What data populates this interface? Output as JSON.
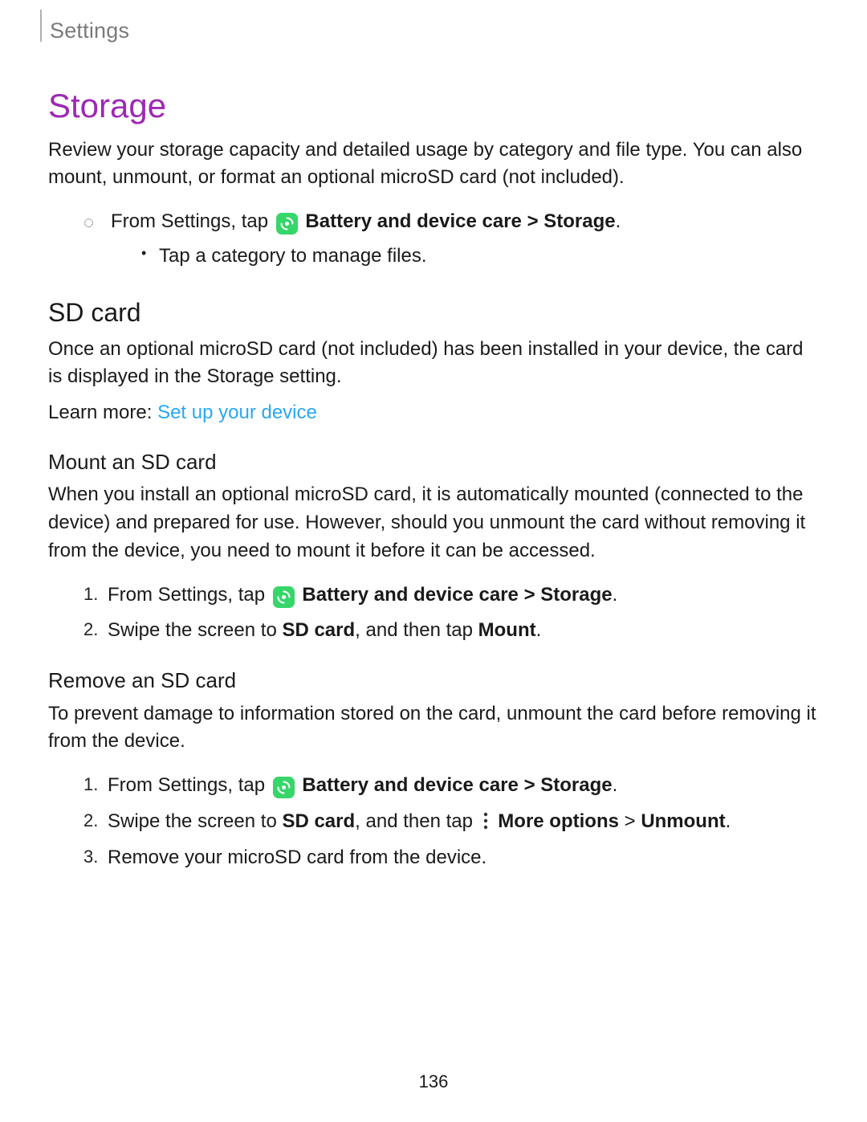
{
  "breadcrumb": "Settings",
  "h1": "Storage",
  "intro": "Review your storage capacity and detailed usage by category and file type.  You can also mount, unmount, or format an optional microSD card (not included).",
  "from_settings_tap": "From Settings, tap",
  "battery_storage_bold": " Battery and device care > Storage",
  "period": ".",
  "tap_category": "Tap a category to manage files.",
  "sd_card": {
    "h2": "SD card",
    "p": "Once an optional microSD card (not included) has been installed in your device, the card is displayed in the Storage setting.",
    "learn_more_label": "Learn more: ",
    "learn_more_link": "Set up your device"
  },
  "mount": {
    "h3": "Mount an SD card",
    "p": "When you install an optional microSD card, it is automatically mounted (connected to the device) and prepared for use. However, should you unmount the card without removing it from the device, you need to mount it before it can be accessed.",
    "step2_a": "Swipe the screen to ",
    "step2_b": "SD card",
    "step2_c": ", and then tap ",
    "step2_d": "Mount",
    "step2_e": "."
  },
  "remove": {
    "h3": "Remove an SD card",
    "p": "To prevent damage to information stored on the card, unmount the card before removing it from the device.",
    "step2_a": "Swipe the screen to ",
    "step2_b": "SD card",
    "step2_c": ", and then tap ",
    "step2_more": " More options",
    "step2_d": " > ",
    "step2_e": "Unmount",
    "step2_f": ".",
    "step3": "Remove your microSD card from the device."
  },
  "page_number": "136"
}
